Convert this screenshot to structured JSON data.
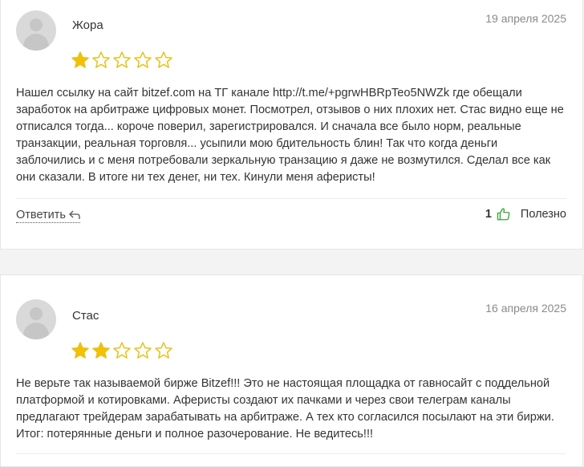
{
  "colors": {
    "star_filled": "#f2c200",
    "star_empty_stroke": "#e6c219",
    "like_green": "#3aa53a"
  },
  "reviews": [
    {
      "author": "Жора",
      "date": "19 апреля 2025",
      "rating": 1,
      "max_rating": 5,
      "text": "Нашел ссылку на сайт bitzef.com на ТГ канале http://t.me/+pgrwHBRpTeo5NWZk где обещали заработок на арбитраже цифровых монет. Посмотрел, отзывов о них плохих нет. Стас видно еще не отписался тогда... короче поверил, зарегистрировался. И сначала все было норм, реальные транзакции, реальная торговля... усыпили мою бдительность блин! Так что когда деньги заблочились и с меня потребовали зеркальную транзацию я даже не возмутился. Сделал все как они сказали. В итоге ни тех денег, ни тех. Кинули меня аферисты!",
      "reply_label": "Ответить",
      "likes": "1",
      "helpful_label": "Полезно"
    },
    {
      "author": "Стас",
      "date": "16 апреля 2025",
      "rating": 2,
      "max_rating": 5,
      "text": "Не верьте так называемой бирже Bitzef!!! Это не настоящая площадка от гавносайт с поддельной платформой и котировками. Аферисты создают их пачками и через свои телеграм каналы предлагают трейдерам зарабатывать на арбитраже. А тех кто согласился посылают на эти биржи. Итог: потерянные деньги и полное разочерование. Не ведитесь!!!"
    }
  ]
}
